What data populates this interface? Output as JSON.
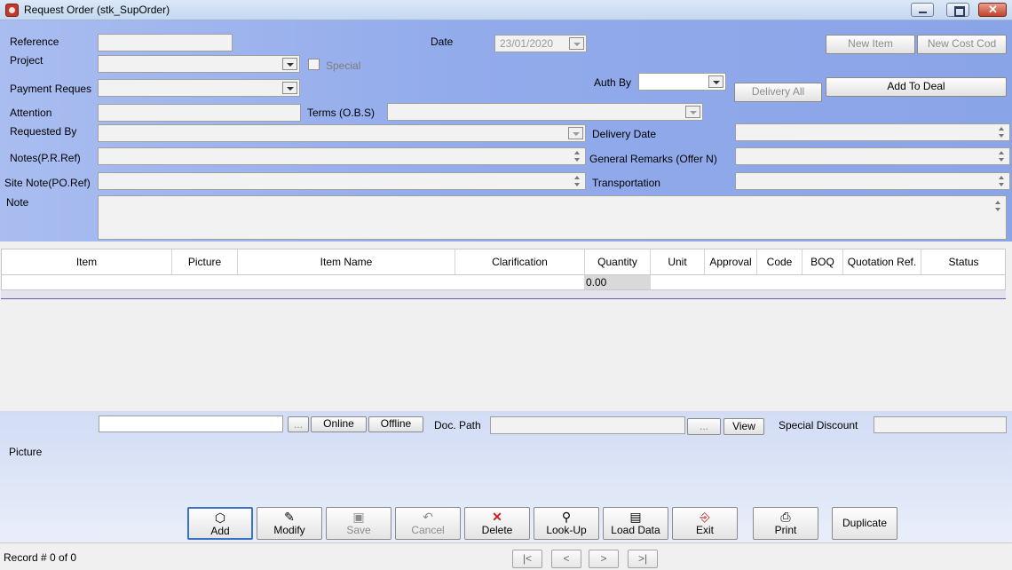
{
  "window": {
    "title": "Request Order  (stk_SupOrder)"
  },
  "form": {
    "reference_label": "Reference",
    "date_label": "Date",
    "date_value": "23/01/2020",
    "project_label": "Project",
    "special_label": "Special",
    "payment_label": "Payment Reques",
    "auth_by_label": "Auth By",
    "attention_label": "Attention",
    "terms_label": "Terms (O.B.S)",
    "requested_by_label": "Requested By",
    "delivery_date_label": "Delivery Date",
    "notes_label": "Notes(P.R.Ref)",
    "general_remarks_label": "General Remarks (Offer N)",
    "site_note_label": "Site Note(PO.Ref)",
    "transportation_label": "Transportation",
    "note_label": "Note"
  },
  "buttons": {
    "new_item": "New Item",
    "new_cost_code": "New Cost Cod",
    "delivery_all": "Delivery All",
    "add_to_deal": "Add To Deal"
  },
  "grid": {
    "columns": [
      "Item",
      "Picture",
      "Item Name",
      "Clarification",
      "Quantity",
      "Unit",
      "Approval",
      "Code",
      "BOQ",
      "Quotation Ref.",
      "Status"
    ],
    "row_quantity": "0.00"
  },
  "footer": {
    "browse": "...",
    "online": "Online",
    "offline": "Offline",
    "doc_path_label": "Doc. Path",
    "doc_browse": "...",
    "view": "View",
    "special_discount_label": "Special Discount",
    "picture_label": "Picture"
  },
  "toolbar": {
    "add": "Add",
    "modify": "Modify",
    "save": "Save",
    "cancel": "Cancel",
    "delete": "Delete",
    "lookup": "Look-Up",
    "load_data": "Load Data",
    "exit": "Exit",
    "print": "Print",
    "duplicate": "Duplicate"
  },
  "status": {
    "record": "Record #  0 of 0"
  },
  "nav": {
    "first": "|<",
    "prev": "<",
    "next": ">",
    "last": ">|"
  }
}
